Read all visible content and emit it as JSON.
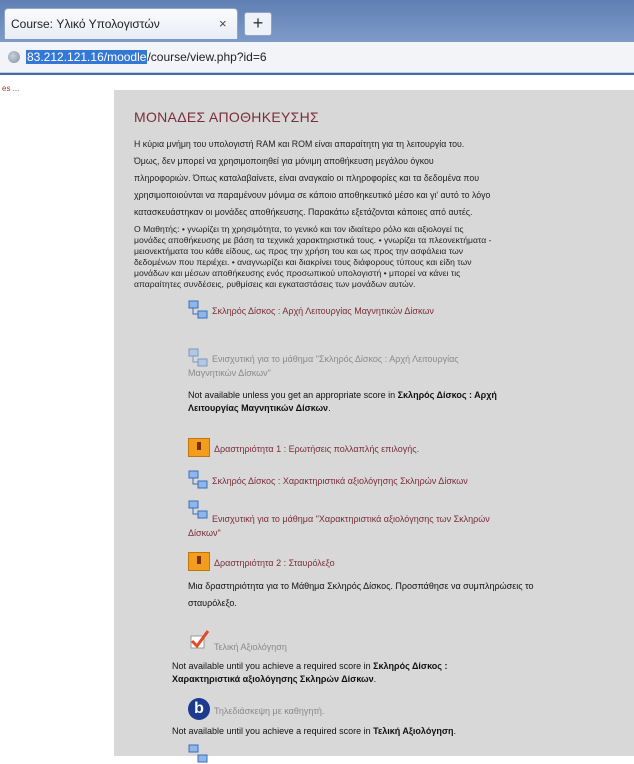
{
  "browser": {
    "tab_title": "Course: Υλικό Υπολογιστών",
    "tab_close": "×",
    "new_tab": "+",
    "url_host": "83.212.121.16/moodle",
    "url_path": "/course/view.php?id=6"
  },
  "sidebar": {
    "truncated_text": "es ..."
  },
  "section": {
    "title": "ΜΟΝΑΔΕΣ ΑΠΟΘΗΚΕΥΣΗΣ",
    "intro_lines": [
      "Η κύρια μνήμη του υπολογιστή RAM και ROM  είναι απαραίτητη για τη λειτουργία του.",
      "Όμως, δεν μπορεί να χρησιμοποιηθεί για μόνιμη αποθήκευση μεγάλου όγκου",
      "πληροφοριών. Όπως καταλαβαίνετε, είναι αναγκαίο οι πληροφορίες και τα δεδομένα που",
      "χρησιμοποιούνται να παραμένουν μόνιμα σε κάποιο αποθηκευτικό μέσο και γι' αυτό το λόγο",
      "κατασκευάστηκαν οι μονάδες αποθήκευσης. Παρακάτω εξετάζονται κάποιες από αυτές."
    ],
    "objectives_lines": [
      "Ο Μαθητής: • γνωρίζει τη χρησιμότητα, το γενικό και τον ιδιαίτερο ρόλο και αξιολογεί τις",
      "μονάδες αποθήκευσης με βάση τα τεχνικά χαρακτηριστικά τους. • γνωρίζει τα πλεονεκτήματα -",
      "μειονεκτήματα του κάθε είδους, ως προς την χρήση του και ως προς την ασφάλεια των",
      "δεδομένων που περιέχει. • αναγνωρίζει και διακρίνει τους διάφορους τύπους και είδη των",
      "μονάδων και μέσων αποθήκευσης ενός προσωπικού υπολογιστή • μπορεί να κάνει τις",
      "απαραίτητες συνδέσεις, ρυθμίσεις και εγκαταστάσεις των μονάδων αυτών."
    ]
  },
  "activities": {
    "a1": "Σκληρός Δίσκος : Αρχή Λειτουργίας Μαγνητικών Δίσκων",
    "a2_line1": "Ενισχυτική για το μάθημα \"Σκληρός Δίσκος : Αρχή Λειτουργίας",
    "a2_line2": "Μαγνητικών Δίσκων\"",
    "a2_note_pre": "Not available unless you get an appropriate score in ",
    "a2_note_bold1": "Σκληρός Δίσκος : Αρχή",
    "a2_note_bold2": "Λειτουργίας Μαγνητικών Δίσκων",
    "a2_note_end": ".",
    "a3": "Δραστηριότητα 1 : Ερωτήσεις πολλαπλής επιλογής.",
    "a4": "Σκληρός Δίσκος : Χαρακτηριστικά αξιολόγησης Σκληρών Δίσκων",
    "a5_line1": "Ενισχυτική για το μάθημα \"Χαρακτηριστικά αξιολόγησης των Σκληρών",
    "a5_line2": "Δίσκων\"",
    "a6": "Δραστηριότητα 2 : Σταυρόλεξο",
    "a6_desc1": "Μια δραστηριότητα για το Μάθημα Σκληρός Δίσκος. Προσπάθησε να συμπληρώσεις το",
    "a6_desc2": "σταυρόλεξο.",
    "a7": "Τελική Αξιολόγηση",
    "a7_note_pre": "Not available until you achieve a required score in ",
    "a7_note_bold1": "Σκληρός Δίσκος :",
    "a7_note_bold2": "Χαρακτηριστικά αξιολόγησης Σκληρών Δίσκων",
    "a7_note_end": ".",
    "a8": "Τηλεδιάσκεψη με καθηγητή.",
    "a8_note_pre": "Not available until you achieve a required score in ",
    "a8_note_bold": "Τελική Αξιολόγηση",
    "a8_note_end": "."
  },
  "colors": {
    "link": "#7a2e3c",
    "content_bg": "#d8d8d8",
    "quiz_icon": "#f29d1d",
    "bbb_icon": "#1e3a8e"
  },
  "icons": {
    "network": "network-icon",
    "quiz": "quiz-icon",
    "check": "checkmark-icon",
    "bigbluebutton": "bigbluebutton-icon"
  }
}
